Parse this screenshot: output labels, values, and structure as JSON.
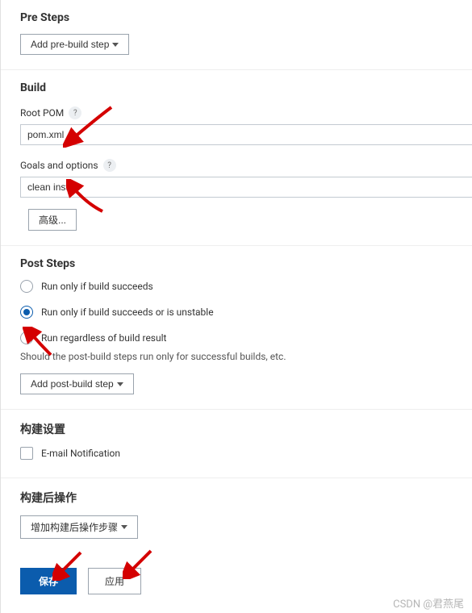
{
  "preSteps": {
    "title": "Pre Steps",
    "addButton": "Add pre-build step"
  },
  "build": {
    "title": "Build",
    "rootPom": {
      "label": "Root POM",
      "value": "pom.xml"
    },
    "goals": {
      "label": "Goals and options",
      "value": "clean install"
    },
    "advanced": "高级..."
  },
  "postSteps": {
    "title": "Post Steps",
    "options": [
      {
        "label": "Run only if build succeeds",
        "selected": false
      },
      {
        "label": "Run only if build succeeds or is unstable",
        "selected": true
      },
      {
        "label": "Run regardless of build result",
        "selected": false
      }
    ],
    "helpText": "Should the post-build steps run only for successful builds, etc.",
    "addButton": "Add post-build step"
  },
  "buildSettings": {
    "title": "构建设置",
    "emailNotification": {
      "label": "E-mail Notification",
      "checked": false
    }
  },
  "postBuildActions": {
    "title": "构建后操作",
    "addButton": "增加构建后操作步骤"
  },
  "actions": {
    "save": "保存",
    "apply": "应用"
  },
  "watermark": "CSDN @君燕尾",
  "colors": {
    "primary": "#0b5cad",
    "arrow": "#d40000"
  }
}
